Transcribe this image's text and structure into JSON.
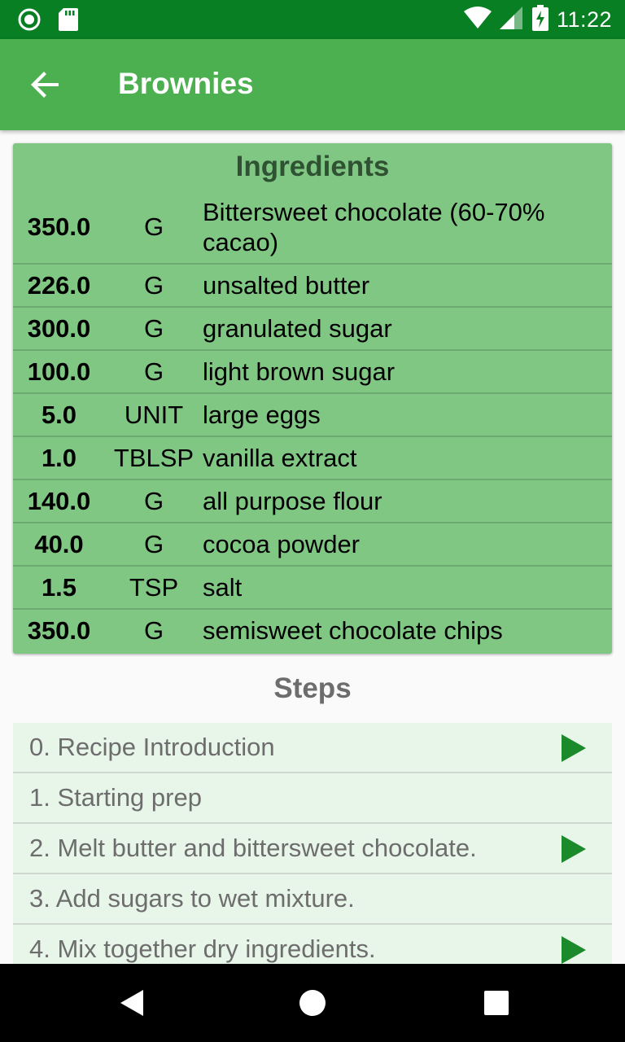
{
  "status_bar": {
    "time": "11:22"
  },
  "app_bar": {
    "title": "Brownies"
  },
  "ingredients": {
    "title": "Ingredients",
    "items": [
      {
        "qty": "350.0",
        "unit": "G",
        "name": "Bittersweet chocolate (60-70% cacao)"
      },
      {
        "qty": "226.0",
        "unit": "G",
        "name": "unsalted butter"
      },
      {
        "qty": "300.0",
        "unit": "G",
        "name": "granulated sugar"
      },
      {
        "qty": "100.0",
        "unit": "G",
        "name": "light brown sugar"
      },
      {
        "qty": "5.0",
        "unit": "UNIT",
        "name": "large eggs"
      },
      {
        "qty": "1.0",
        "unit": "TBLSP",
        "name": "vanilla extract"
      },
      {
        "qty": "140.0",
        "unit": "G",
        "name": "all purpose flour"
      },
      {
        "qty": "40.0",
        "unit": "G",
        "name": "cocoa powder"
      },
      {
        "qty": "1.5",
        "unit": "TSP",
        "name": "salt"
      },
      {
        "qty": "350.0",
        "unit": "G",
        "name": "semisweet chocolate chips"
      }
    ]
  },
  "steps": {
    "title": "Steps",
    "items": [
      {
        "label": "0. Recipe Introduction",
        "has_video": true
      },
      {
        "label": "1. Starting prep",
        "has_video": false
      },
      {
        "label": "2. Melt butter and bittersweet chocolate.",
        "has_video": true
      },
      {
        "label": "3. Add sugars to wet mixture.",
        "has_video": false
      },
      {
        "label": "4. Mix together dry ingredients.",
        "has_video": true
      }
    ]
  },
  "colors": {
    "status_bar": "#087f23",
    "app_bar": "#4caf50",
    "ingredients_card": "#81c784",
    "step_row": "#e8f5e9",
    "play_icon": "#1b8a2a"
  },
  "icons": {
    "status_left": [
      "app-notification-icon",
      "sd-card-icon"
    ],
    "status_right": [
      "wifi-icon",
      "cell-signal-icon",
      "battery-charging-icon"
    ],
    "app_bar": "back-arrow-icon",
    "step_video": "play-icon",
    "nav": [
      "nav-back-icon",
      "nav-home-icon",
      "nav-recents-icon"
    ]
  }
}
